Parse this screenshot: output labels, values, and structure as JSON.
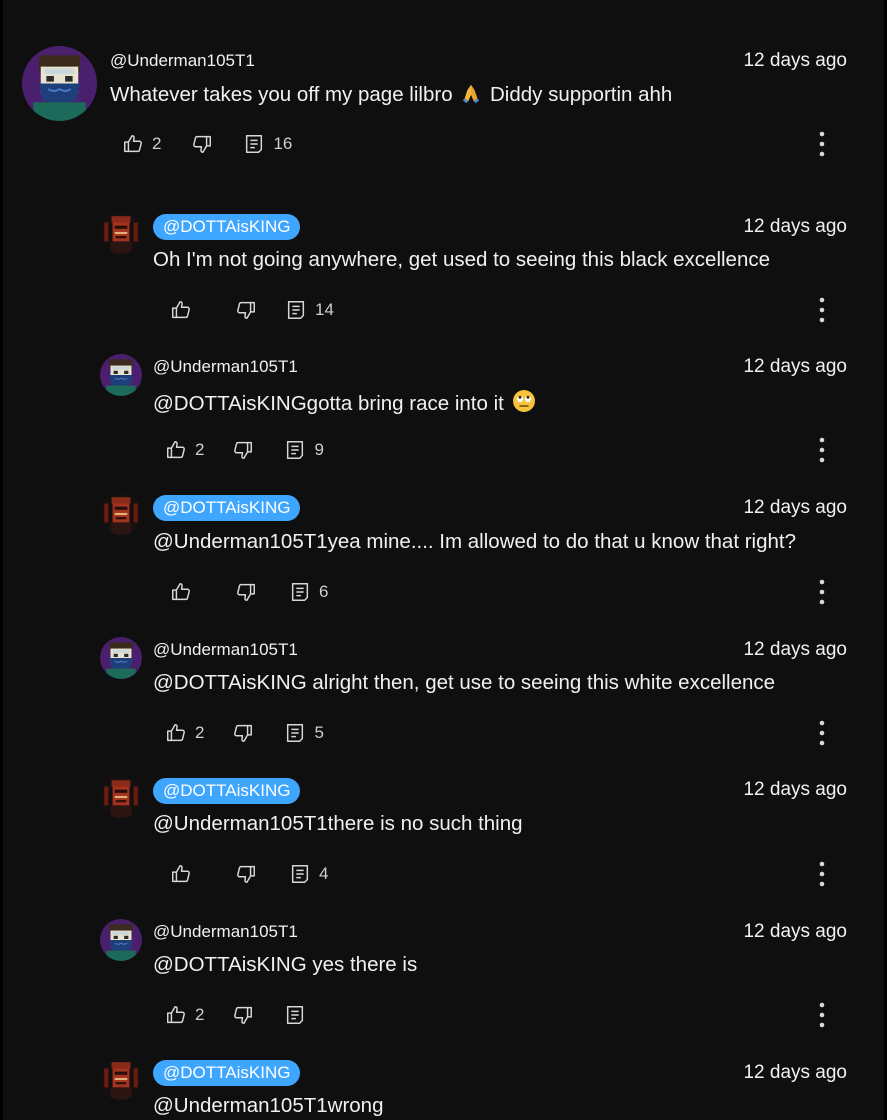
{
  "colors": {
    "background": "#0f0f0f",
    "text": "#f1f1f1",
    "handle_pill": "#3ea6ff"
  },
  "top_comment": {
    "author": "@Underman105T1",
    "time": "12 days ago",
    "text_before_emoji": "Whatever takes you off my page lilbro ",
    "emoji": "folded-hands-emoji",
    "text_after_emoji": " Diddy supportin ahh",
    "likes": "2",
    "replies": "16"
  },
  "replies": [
    {
      "author": "@DOTTAisKING",
      "time": "12 days ago",
      "text": "Oh I'm not going anywhere, get used to seeing this black excellence",
      "likes": "",
      "replies": "14"
    },
    {
      "author": "@Underman105T1",
      "time": "12 days ago",
      "text": "@DOTTAisKINGgotta bring race into it ",
      "emoji": "face-with-rolling-eyes-emoji",
      "likes": "2",
      "replies": "9"
    },
    {
      "author": "@DOTTAisKING",
      "time": "12 days ago",
      "text": "@Underman105T1yea mine.... Im allowed to do that u know that right?",
      "likes": "",
      "replies": "6"
    },
    {
      "author": "@Underman105T1",
      "time": "12 days ago",
      "text": "@DOTTAisKING alright then, get use to seeing this white excellence",
      "likes": "2",
      "replies": "5"
    },
    {
      "author": "@DOTTAisKING",
      "time": "12 days ago",
      "text": "@Underman105T1there is no such thing",
      "likes": "",
      "replies": "4"
    },
    {
      "author": "@Underman105T1",
      "time": "12 days ago",
      "text": "@DOTTAisKING yes there is",
      "likes": "2",
      "replies": ""
    },
    {
      "author": "@DOTTAisKING",
      "time": "12 days ago",
      "text": "@Underman105T1wrong"
    }
  ]
}
